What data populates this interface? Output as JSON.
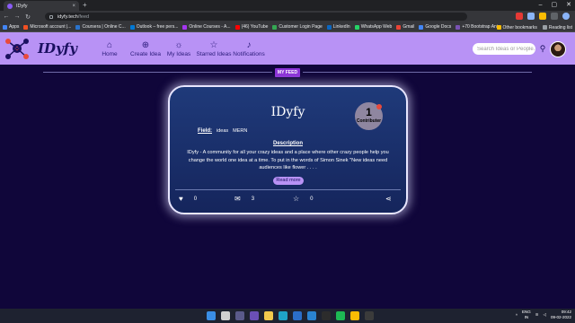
{
  "browser": {
    "tab_title": "IDyfy",
    "url_domain": "idyfy.tech",
    "url_path": "/feed",
    "bookmarks": [
      {
        "label": "Apps",
        "color": "#4285f4"
      },
      {
        "label": "Microsoft account |...",
        "color": "#f25022"
      },
      {
        "label": "Coursera | Online C...",
        "color": "#2a73cc"
      },
      {
        "label": "Outlook – free pers...",
        "color": "#0078d4"
      },
      {
        "label": "Online Courses - A...",
        "color": "#a435f0"
      },
      {
        "label": "(46) YouTube",
        "color": "#ff0000"
      },
      {
        "label": "Customer Login Page",
        "color": "#34a853"
      },
      {
        "label": "LinkedIn",
        "color": "#0a66c2"
      },
      {
        "label": "WhatsApp Web",
        "color": "#25d366"
      },
      {
        "label": "Gmail",
        "color": "#ea4335"
      },
      {
        "label": "Google Docs",
        "color": "#4285f4"
      },
      {
        "label": "+70 Bootstrap Ani...",
        "color": "#7952b3"
      }
    ],
    "other_bookmarks": "Other bookmarks",
    "reading_list": "Reading list"
  },
  "app": {
    "brand": "IDyfy",
    "nav": [
      {
        "label": "Home",
        "icon": "home-icon",
        "glyph": "⌂"
      },
      {
        "label": "Create Idea",
        "icon": "plus-circle-icon",
        "glyph": "⊕"
      },
      {
        "label": "My Ideas",
        "icon": "bulb-icon",
        "glyph": "☼"
      },
      {
        "label": "Starred Ideas",
        "icon": "star-icon",
        "glyph": "☆"
      },
      {
        "label": "Notifications",
        "icon": "bell-icon",
        "glyph": "♪"
      }
    ],
    "search_placeholder": "Search Ideas or People...",
    "accent": "#b892f5",
    "background": "#10063a"
  },
  "feed": {
    "badge": "MY FEED",
    "card": {
      "title": "IDyfy",
      "contributors_count": "1",
      "contributors_label": "Contributer",
      "field_label": "Field:",
      "fields": [
        "ideas",
        "MERN"
      ],
      "description_heading": "Description",
      "description": "IDyfy - A community for all your crazy ideas and a place where other crazy people help you change the world one idea at a time. To put in the words of Simon Sinek \"New ideas need audiences like flower . . . .",
      "read_more": "Read more",
      "likes": "0",
      "comments": "3",
      "stars": "0"
    }
  },
  "taskbar": {
    "lang_line1": "ENG",
    "lang_line2": "IN",
    "time": "09:42",
    "date": "09-02-2022"
  }
}
